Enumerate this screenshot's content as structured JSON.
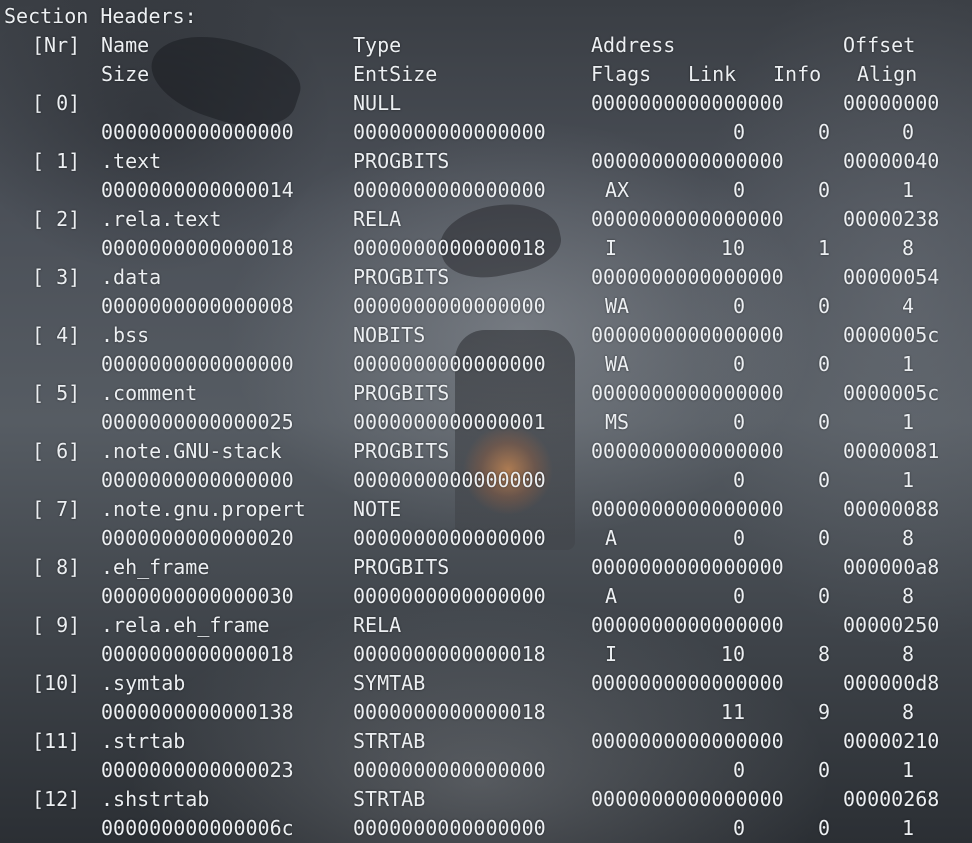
{
  "terminal": {
    "title_line": "Section Headers:",
    "header": {
      "nr": "[Nr]",
      "name": "Name",
      "type": "Type",
      "address": "Address",
      "offset": "Offset",
      "size": "Size",
      "entsize": "EntSize",
      "flags": "Flags",
      "link": "Link",
      "info": "Info",
      "align": "Align"
    },
    "sections": [
      {
        "nr": "[ 0]",
        "name": "",
        "type": "NULL",
        "address": "0000000000000000",
        "offset": "00000000",
        "size": "0000000000000000",
        "entsize": "0000000000000000",
        "flags": "",
        "link": "0",
        "info": "0",
        "align": "0"
      },
      {
        "nr": "[ 1]",
        "name": ".text",
        "type": "PROGBITS",
        "address": "0000000000000000",
        "offset": "00000040",
        "size": "0000000000000014",
        "entsize": "0000000000000000",
        "flags": "AX",
        "link": "0",
        "info": "0",
        "align": "1"
      },
      {
        "nr": "[ 2]",
        "name": ".rela.text",
        "type": "RELA",
        "address": "0000000000000000",
        "offset": "00000238",
        "size": "0000000000000018",
        "entsize": "0000000000000018",
        "flags": "I",
        "link": "10",
        "info": "1",
        "align": "8"
      },
      {
        "nr": "[ 3]",
        "name": ".data",
        "type": "PROGBITS",
        "address": "0000000000000000",
        "offset": "00000054",
        "size": "0000000000000008",
        "entsize": "0000000000000000",
        "flags": "WA",
        "link": "0",
        "info": "0",
        "align": "4"
      },
      {
        "nr": "[ 4]",
        "name": ".bss",
        "type": "NOBITS",
        "address": "0000000000000000",
        "offset": "0000005c",
        "size": "0000000000000000",
        "entsize": "0000000000000000",
        "flags": "WA",
        "link": "0",
        "info": "0",
        "align": "1"
      },
      {
        "nr": "[ 5]",
        "name": ".comment",
        "type": "PROGBITS",
        "address": "0000000000000000",
        "offset": "0000005c",
        "size": "0000000000000025",
        "entsize": "0000000000000001",
        "flags": "MS",
        "link": "0",
        "info": "0",
        "align": "1"
      },
      {
        "nr": "[ 6]",
        "name": ".note.GNU-stack",
        "type": "PROGBITS",
        "address": "0000000000000000",
        "offset": "00000081",
        "size": "0000000000000000",
        "entsize": "0000000000000000",
        "flags": "",
        "link": "0",
        "info": "0",
        "align": "1"
      },
      {
        "nr": "[ 7]",
        "name": ".note.gnu.propert",
        "type": "NOTE",
        "address": "0000000000000000",
        "offset": "00000088",
        "size": "0000000000000020",
        "entsize": "0000000000000000",
        "flags": "A",
        "link": "0",
        "info": "0",
        "align": "8"
      },
      {
        "nr": "[ 8]",
        "name": ".eh_frame",
        "type": "PROGBITS",
        "address": "0000000000000000",
        "offset": "000000a8",
        "size": "0000000000000030",
        "entsize": "0000000000000000",
        "flags": "A",
        "link": "0",
        "info": "0",
        "align": "8"
      },
      {
        "nr": "[ 9]",
        "name": ".rela.eh_frame",
        "type": "RELA",
        "address": "0000000000000000",
        "offset": "00000250",
        "size": "0000000000000018",
        "entsize": "0000000000000018",
        "flags": "I",
        "link": "10",
        "info": "8",
        "align": "8"
      },
      {
        "nr": "[10]",
        "name": ".symtab",
        "type": "SYMTAB",
        "address": "0000000000000000",
        "offset": "000000d8",
        "size": "0000000000000138",
        "entsize": "0000000000000018",
        "flags": "",
        "link": "11",
        "info": "9",
        "align": "8"
      },
      {
        "nr": "[11]",
        "name": ".strtab",
        "type": "STRTAB",
        "address": "0000000000000000",
        "offset": "00000210",
        "size": "0000000000000023",
        "entsize": "0000000000000000",
        "flags": "",
        "link": "0",
        "info": "0",
        "align": "1"
      },
      {
        "nr": "[12]",
        "name": ".shstrtab",
        "type": "STRTAB",
        "address": "0000000000000000",
        "offset": "00000268",
        "size": "000000000000006c",
        "entsize": "0000000000000000",
        "flags": "",
        "link": "0",
        "info": "0",
        "align": "1"
      }
    ]
  }
}
